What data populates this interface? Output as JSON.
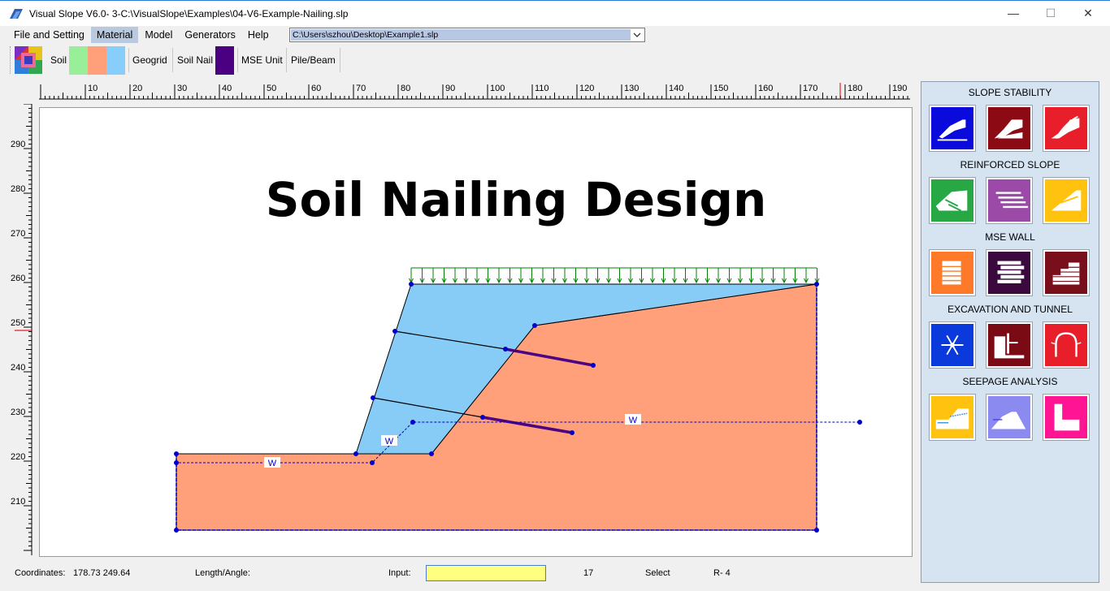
{
  "window": {
    "title": "Visual Slope V6.0- 3-C:\\VisualSlope\\Examples\\04-V6-Example-Nailing.slp",
    "minimize": "—",
    "maximize": "☐",
    "close": "✕"
  },
  "menu": {
    "items": [
      "File and Setting",
      "Material",
      "Model",
      "Generators",
      "Help"
    ],
    "active": "Material",
    "file_path": "C:\\Users\\szhou\\Desktop\\Example1.slp"
  },
  "toolbar": {
    "soil_label": "Soil",
    "geogrid_label": "Geogrid",
    "soil_nail_label": "Soil Nail",
    "mse_unit_label": "MSE Unit",
    "pile_beam_label": "Pile/Beam",
    "swatch_colors": [
      "#99ee99",
      "#ffa07a",
      "#87cefa"
    ],
    "nail_color": "#4b0082"
  },
  "rulers": {
    "top_labels": [
      "10",
      "20",
      "30",
      "40",
      "50",
      "60",
      "70",
      "80",
      "90",
      "100",
      "110",
      "120",
      "130",
      "140",
      "150",
      "160",
      "170",
      "180",
      "190"
    ],
    "left_labels": [
      "290",
      "280",
      "270",
      "260",
      "250",
      "240",
      "230",
      "220",
      "210"
    ]
  },
  "canvas": {
    "heading": "Soil Nailing Design",
    "water_label": "W",
    "colors": {
      "upper_soil": "#87cbf7",
      "lower_soil": "#ffa07a",
      "load_arrows": "#008000",
      "nail": "#4b0082",
      "water": "#0000cc",
      "nodes": "#0000cc"
    }
  },
  "panel": {
    "sections": [
      {
        "title": "SLOPE STABILITY",
        "buttons": [
          {
            "name": "slope-stability-basic-button",
            "icon": "slope-icon",
            "color": "#0a0adc"
          },
          {
            "name": "slope-stability-layered-button",
            "icon": "slope-layers-icon",
            "color": "#8b0a14"
          },
          {
            "name": "slope-stability-advanced-button",
            "icon": "slope-analysis-icon",
            "color": "#e81f2a"
          }
        ]
      },
      {
        "title": "REINFORCED SLOPE",
        "buttons": [
          {
            "name": "reinforced-nail-button",
            "icon": "nailed-slope-icon",
            "color": "#28a745"
          },
          {
            "name": "reinforced-geogrid-button",
            "icon": "geogrid-slope-icon",
            "color": "#9b4aa8"
          },
          {
            "name": "reinforced-anchor-button",
            "icon": "anchor-slope-icon",
            "color": "#ffc20e"
          }
        ]
      },
      {
        "title": "MSE WALL",
        "buttons": [
          {
            "name": "mse-block-wall-button",
            "icon": "block-wall-icon",
            "color": "#ff7a28"
          },
          {
            "name": "mse-segmental-wall-button",
            "icon": "segmental-wall-icon",
            "color": "#3a0a3e"
          },
          {
            "name": "mse-tiered-wall-button",
            "icon": "tiered-wall-icon",
            "color": "#7a0f1c"
          }
        ]
      },
      {
        "title": "EXCAVATION AND TUNNEL",
        "buttons": [
          {
            "name": "frozen-ground-button",
            "icon": "snowflake-icon",
            "color": "#0a3adc"
          },
          {
            "name": "excavation-wall-button",
            "icon": "excavation-icon",
            "color": "#7a0a14"
          },
          {
            "name": "tunnel-button",
            "icon": "tunnel-icon",
            "color": "#e81f2a"
          }
        ]
      },
      {
        "title": "SEEPAGE ANALYSIS",
        "buttons": [
          {
            "name": "seepage-slope-button",
            "icon": "seepage-slope-icon",
            "color": "#ffc20e"
          },
          {
            "name": "seepage-dam-button",
            "icon": "seepage-dam-icon",
            "color": "#8a8af0"
          },
          {
            "name": "seepage-wall-button",
            "icon": "seepage-wall-icon",
            "color": "#ff1493"
          }
        ]
      }
    ]
  },
  "status": {
    "coordinates_label": "Coordinates:",
    "coordinates_value": "178.73  249.64",
    "length_label": "Length/Angle:",
    "input_label": "Input:",
    "count": "17",
    "mode": "Select",
    "row": "R- 4"
  }
}
